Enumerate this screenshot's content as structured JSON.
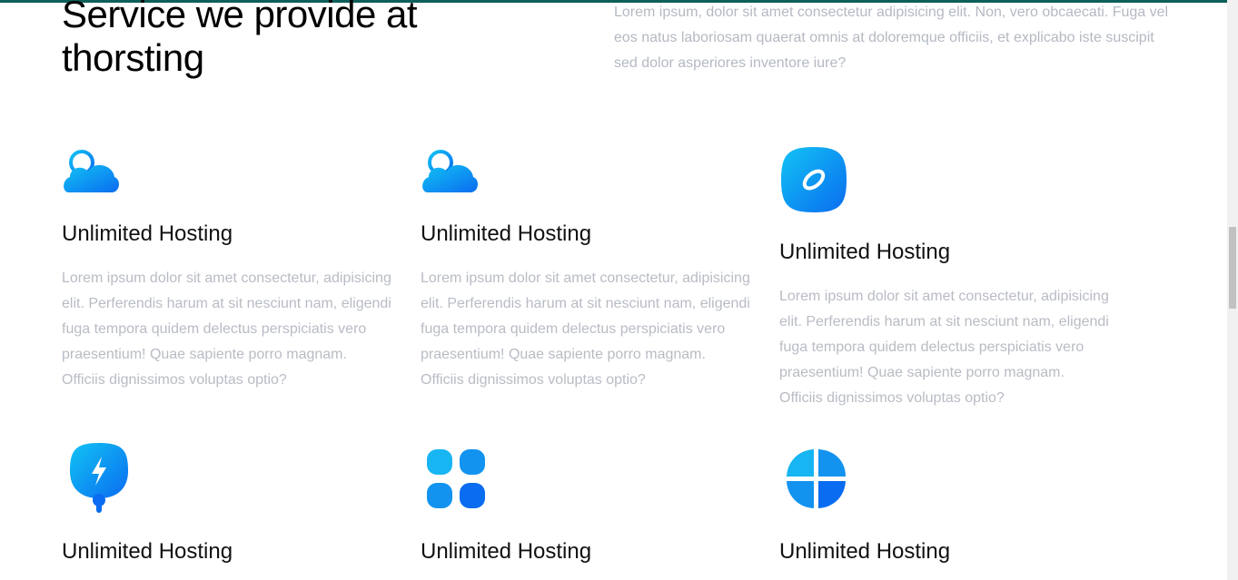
{
  "section": {
    "heading": "Service we provide at thorsting",
    "intro": "Lorem ipsum, dolor sit amet consectetur adipisicing elit. Non, vero obcaecati. Fuga vel eos natus laboriosam quaerat omnis at doloremque officiis, et explicabo iste suscipit sed dolor asperiores inventore iure?"
  },
  "services": [
    {
      "icon": "cloud-icon",
      "title": "Unlimited Hosting",
      "description": "Lorem ipsum dolor sit amet consectetur, adipisicing elit. Perferendis harum at sit nesciunt nam, eligendi fuga tempora quidem delectus perspiciatis vero praesentium! Quae sapiente porro magnam. Officiis dignissimos voluptas optio?"
    },
    {
      "icon": "cloud-icon",
      "title": "Unlimited Hosting",
      "description": "Lorem ipsum dolor sit amet consectetur, adipisicing elit. Perferendis harum at sit nesciunt nam, eligendi fuga tempora quidem delectus perspiciatis vero praesentium! Quae sapiente porro magnam. Officiis dignissimos voluptas optio?"
    },
    {
      "icon": "planet-icon",
      "title": "Unlimited Hosting",
      "description": "Lorem ipsum dolor sit amet consectetur, adipisicing elit. Perferendis harum at sit nesciunt nam, eligendi fuga tempora quidem delectus perspiciatis vero praesentium! Quae sapiente porro magnam. Officiis dignissimos voluptas optio?"
    },
    {
      "icon": "power-bolt-icon",
      "title": "Unlimited Hosting"
    },
    {
      "icon": "apps-grid-icon",
      "title": "Unlimited Hosting"
    },
    {
      "icon": "pie-chart-icon",
      "title": "Unlimited Hosting"
    }
  ],
  "colors": {
    "accent_light": "#12c3f4",
    "accent_dark": "#0a6cf0",
    "top_bar": "#0e5f5a",
    "muted_text": "#b8bcc4"
  }
}
